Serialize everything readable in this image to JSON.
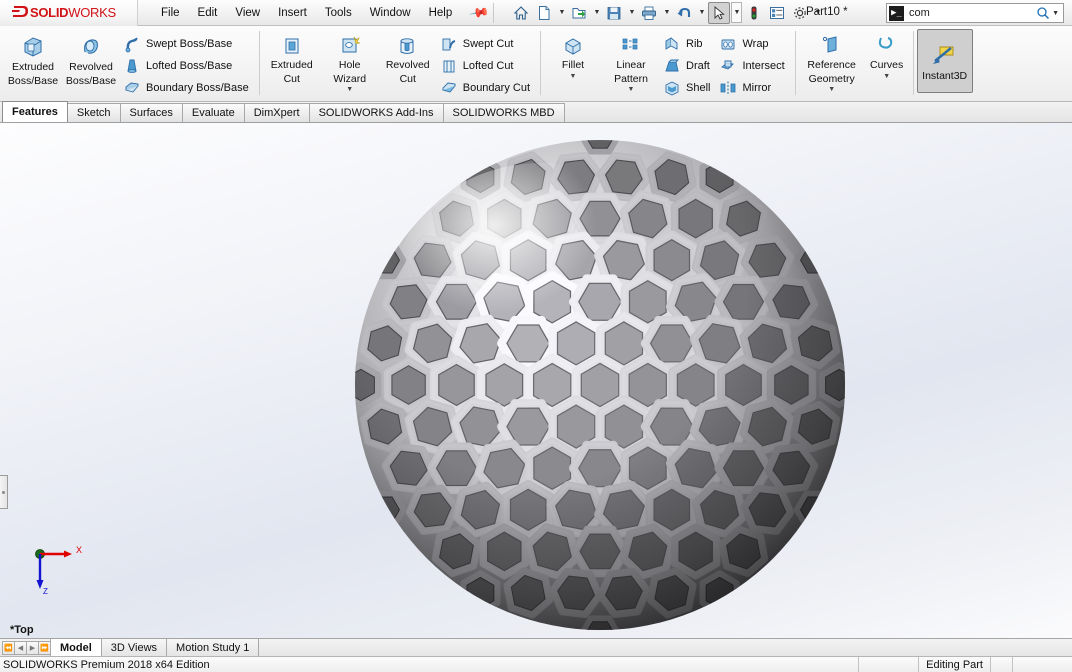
{
  "app": {
    "brand_ds": "2S",
    "brand_solid": "SOLID",
    "brand_works": "WORKS",
    "document_title": "Part10 *",
    "accent_red": "#d11317",
    "accent_blue": "#2a7ab0"
  },
  "menu": {
    "items": [
      {
        "label": "File"
      },
      {
        "label": "Edit"
      },
      {
        "label": "View"
      },
      {
        "label": "Insert"
      },
      {
        "label": "Tools"
      },
      {
        "label": "Window"
      },
      {
        "label": "Help"
      }
    ],
    "pin_icon": "pushpin-icon"
  },
  "quick_toolbar": {
    "buttons": [
      {
        "name": "home-icon",
        "caret": false,
        "pressed": false
      },
      {
        "name": "new-document-icon",
        "caret": true,
        "pressed": false
      },
      {
        "name": "open-folder-icon",
        "caret": true,
        "pressed": false
      },
      {
        "name": "save-icon",
        "caret": true,
        "pressed": false
      },
      {
        "name": "print-icon",
        "caret": true,
        "pressed": false
      },
      {
        "name": "undo-icon",
        "caret": true,
        "pressed": false
      },
      {
        "name": "select-cursor-icon",
        "caret": true,
        "pressed": true
      },
      {
        "name": "rebuild-icon",
        "caret": false,
        "pressed": false
      },
      {
        "name": "display-style-icon",
        "caret": false,
        "pressed": false
      },
      {
        "name": "options-gear-icon",
        "caret": true,
        "pressed": false
      }
    ]
  },
  "search": {
    "command_badge": "▶_",
    "value": "com",
    "placeholder": "Search",
    "magnifier_icon": "magnifier-icon"
  },
  "ribbon": {
    "groups": [
      {
        "name": "boss-base-group",
        "big": [
          {
            "label_line1": "Extruded",
            "label_line2": "Boss/Base",
            "icon": "extruded-boss-icon",
            "caret": false
          },
          {
            "label_line1": "Revolved",
            "label_line2": "Boss/Base",
            "icon": "revolved-boss-icon",
            "caret": false
          }
        ],
        "small": [
          {
            "label": "Swept Boss/Base",
            "icon": "swept-boss-icon"
          },
          {
            "label": "Lofted Boss/Base",
            "icon": "lofted-boss-icon"
          },
          {
            "label": "Boundary Boss/Base",
            "icon": "boundary-boss-icon"
          }
        ]
      },
      {
        "name": "cut-group",
        "big": [
          {
            "label_line1": "Extruded",
            "label_line2": "Cut",
            "icon": "extruded-cut-icon",
            "caret": false
          },
          {
            "label_line1": "Hole",
            "label_line2": "Wizard",
            "icon": "hole-wizard-icon",
            "caret": true
          },
          {
            "label_line1": "Revolved",
            "label_line2": "Cut",
            "icon": "revolved-cut-icon",
            "caret": false
          }
        ],
        "small": [
          {
            "label": "Swept Cut",
            "icon": "swept-cut-icon"
          },
          {
            "label": "Lofted Cut",
            "icon": "lofted-cut-icon"
          },
          {
            "label": "Boundary Cut",
            "icon": "boundary-cut-icon"
          }
        ]
      },
      {
        "name": "feature-group",
        "big": [
          {
            "label_line1": "Fillet",
            "label_line2": "",
            "icon": "fillet-icon",
            "caret": true
          },
          {
            "label_line1": "Linear",
            "label_line2": "Pattern",
            "icon": "linear-pattern-icon",
            "caret": true
          }
        ],
        "small": [
          {
            "label": "Rib",
            "icon": "rib-icon"
          },
          {
            "label": "Draft",
            "icon": "draft-icon"
          },
          {
            "label": "Shell",
            "icon": "shell-icon"
          }
        ],
        "small2": [
          {
            "label": "Wrap",
            "icon": "wrap-icon"
          },
          {
            "label": "Intersect",
            "icon": "intersect-icon"
          },
          {
            "label": "Mirror",
            "icon": "mirror-icon"
          }
        ]
      },
      {
        "name": "reference-group",
        "big": [
          {
            "label_line1": "Reference",
            "label_line2": "Geometry",
            "icon": "reference-geometry-icon",
            "caret": true
          },
          {
            "label_line1": "Curves",
            "label_line2": "",
            "icon": "curves-icon",
            "caret": true
          }
        ],
        "small": []
      },
      {
        "name": "instant3d-group",
        "big": [
          {
            "label_line1": "Instant3D",
            "label_line2": "",
            "icon": "instant3d-icon",
            "caret": false,
            "active": true
          }
        ],
        "small": []
      }
    ]
  },
  "command_tabs": {
    "items": [
      {
        "label": "Features",
        "active": true
      },
      {
        "label": "Sketch",
        "active": false
      },
      {
        "label": "Surfaces",
        "active": false
      },
      {
        "label": "Evaluate",
        "active": false
      },
      {
        "label": "DimXpert",
        "active": false
      },
      {
        "label": "SOLIDWORKS Add-Ins",
        "active": false
      },
      {
        "label": "SOLIDWORKS MBD",
        "active": false
      }
    ]
  },
  "viewport": {
    "view_orientation_label": "*Top",
    "axis_x_label": "X",
    "axis_z_label": "Z",
    "axis_x_color": "#e00000",
    "axis_z_color": "#1414d0",
    "origin_color": "#1a6b1a",
    "panel_handle": "feature-manager-collapse-handle",
    "model_description": "hexagonal lattice sphere",
    "model_color_light": "#e9e9ea",
    "model_color_mid": "#9b9b9e",
    "model_color_dark": "#5e5e62"
  },
  "bottom_tabs": {
    "nav": [
      "first",
      "previous",
      "next",
      "last"
    ],
    "items": [
      {
        "label": "Model",
        "active": true
      },
      {
        "label": "3D Views",
        "active": false
      },
      {
        "label": "Motion Study 1",
        "active": false
      }
    ]
  },
  "status_bar": {
    "edition": "SOLIDWORKS Premium 2018 x64 Edition",
    "editing_state": "Editing Part",
    "units": ""
  }
}
